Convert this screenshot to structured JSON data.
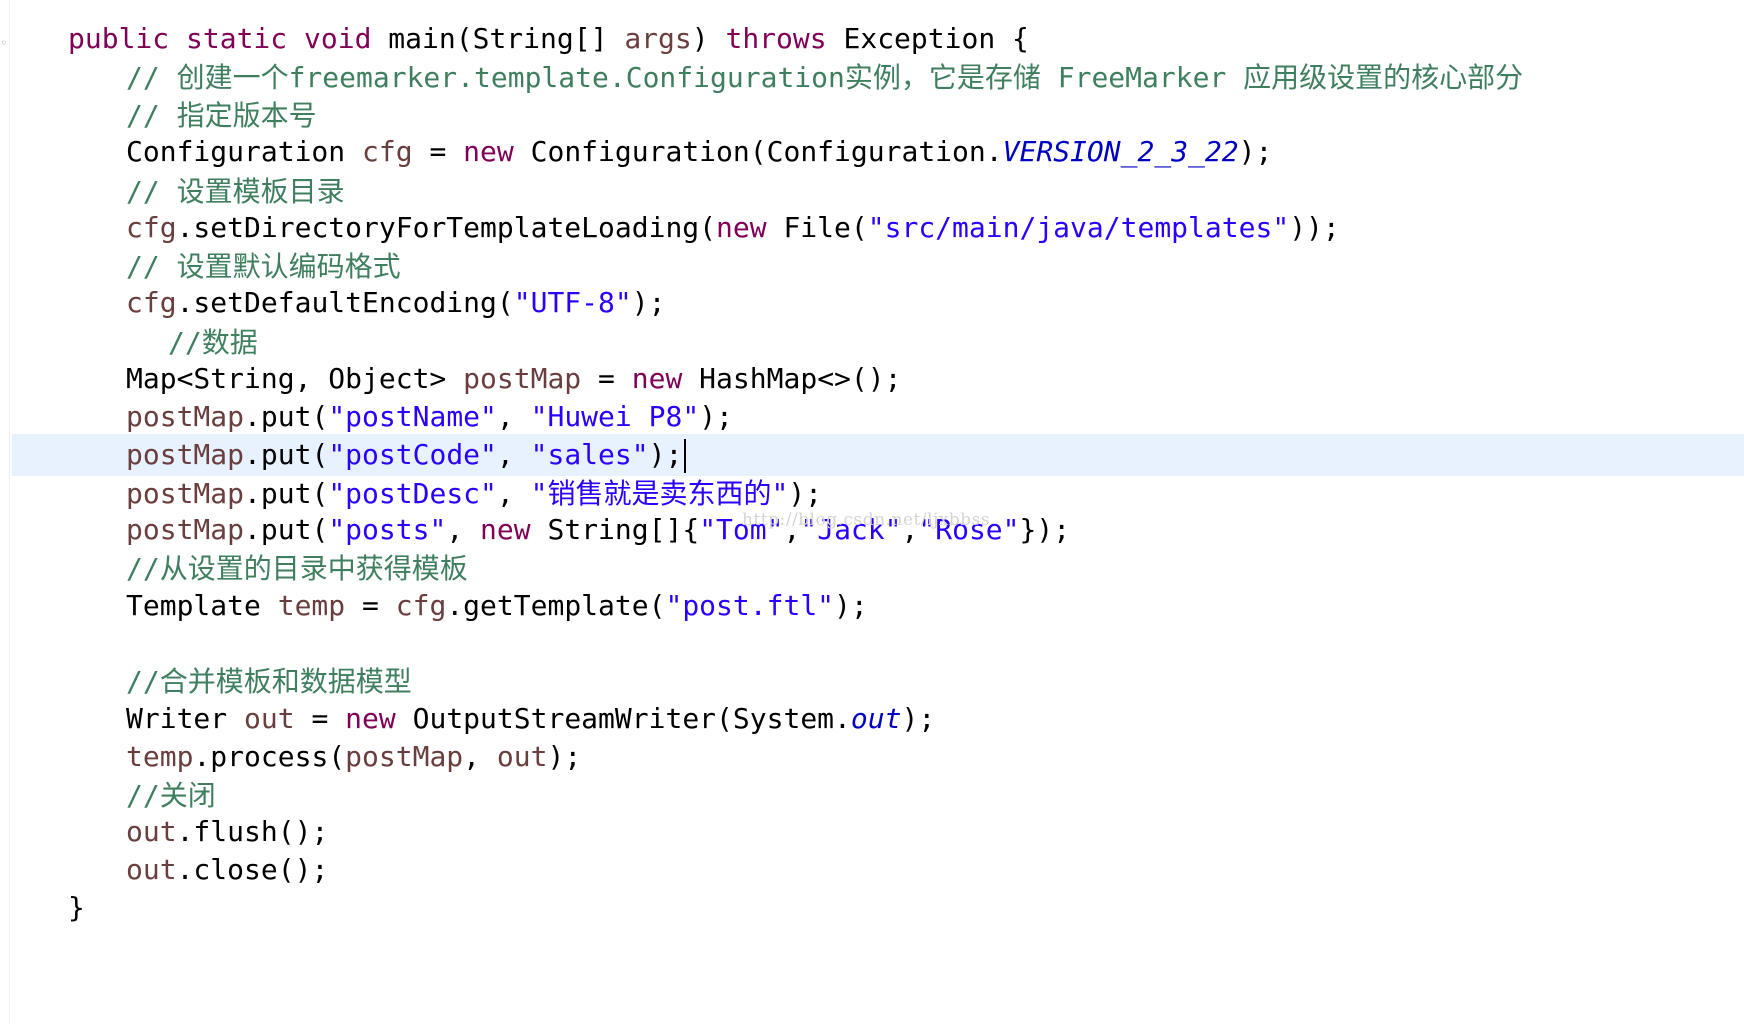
{
  "watermark": "http://blog.csdn.net/ljxbbss",
  "colors": {
    "keyword": "#7f0055",
    "string": "#2a00ff",
    "comment": "#3f7f5f",
    "static_field": "#0000c0",
    "local_variable": "#6a3e3e",
    "current_line_highlight": "#e8f2fe"
  },
  "code": {
    "l1": {
      "kw1": "public static void ",
      "t1": "main(String[] ",
      "v1": "args",
      "t2": ") ",
      "kw2": "throws",
      "t3": " Exception {"
    },
    "l2": {
      "c": "// 创建一个freemarker.template.Configuration实例，它是存储 FreeMarker 应用级设置的核心部分"
    },
    "l3": {
      "c": "// 指定版本号"
    },
    "l4": {
      "t1": "Configuration ",
      "v1": "cfg",
      "t2": " = ",
      "kw1": "new",
      "t3": " Configuration(Configuration.",
      "f1": "VERSION_2_3_22",
      "t4": ");"
    },
    "l5": {
      "c": "// 设置模板目录"
    },
    "l6": {
      "v1": "cfg",
      "t1": ".setDirectoryForTemplateLoading(",
      "kw1": "new",
      "t2": " File(",
      "s1": "\"src/main/java/templates\"",
      "t3": "));"
    },
    "l7": {
      "c": "// 设置默认编码格式"
    },
    "l8": {
      "v1": "cfg",
      "t1": ".setDefaultEncoding(",
      "s1": "\"UTF-8\"",
      "t2": ");"
    },
    "l9": {
      "c": "//数据"
    },
    "l10": {
      "t1": "Map<String, Object> ",
      "v1": "postMap",
      "t2": " = ",
      "kw1": "new",
      "t3": " HashMap<>();"
    },
    "l11": {
      "v1": "postMap",
      "t1": ".put(",
      "s1": "\"postName\"",
      "t2": ", ",
      "s2": "\"Huwei P8\"",
      "t3": ");"
    },
    "l12": {
      "v1": "postMap",
      "t1": ".put(",
      "s1": "\"postCode\"",
      "t2": ", ",
      "s2": "\"sales\"",
      "t3": ");"
    },
    "l13": {
      "v1": "postMap",
      "t1": ".put(",
      "s1": "\"postDesc\"",
      "t2": ", ",
      "s2": "\"销售就是卖东西的\"",
      "t3": ");"
    },
    "l14": {
      "v1": "postMap",
      "t1": ".put(",
      "s1": "\"posts\"",
      "t2": ", ",
      "kw1": "new",
      "t3": " String[]{",
      "s2": "\"Tom\"",
      "t4": ",",
      "s3": "\"Jack\"",
      "t5": ",",
      "s4": "\"Rose\"",
      "t6": "});"
    },
    "l15": {
      "c": "//从设置的目录中获得模板"
    },
    "l16": {
      "t1": "Template ",
      "v1": "temp",
      "t2": " = ",
      "v2": "cfg",
      "t3": ".getTemplate(",
      "s1": "\"post.ftl\"",
      "t4": ");"
    },
    "l17": {
      "c": "//合并模板和数据模型"
    },
    "l18": {
      "t1": "Writer ",
      "v1": "out",
      "t2": " = ",
      "kw1": "new",
      "t3": " OutputStreamWriter(System.",
      "f1": "out",
      "t4": ");"
    },
    "l19": {
      "v1": "temp",
      "t1": ".process(",
      "v2": "postMap",
      "t2": ", ",
      "v3": "out",
      "t3": ");"
    },
    "l20": {
      "c": "//关闭"
    },
    "l21": {
      "v1": "out",
      "t1": ".flush();"
    },
    "l22": {
      "v1": "out",
      "t1": ".close();"
    },
    "l23": {
      "t1": "}"
    }
  }
}
